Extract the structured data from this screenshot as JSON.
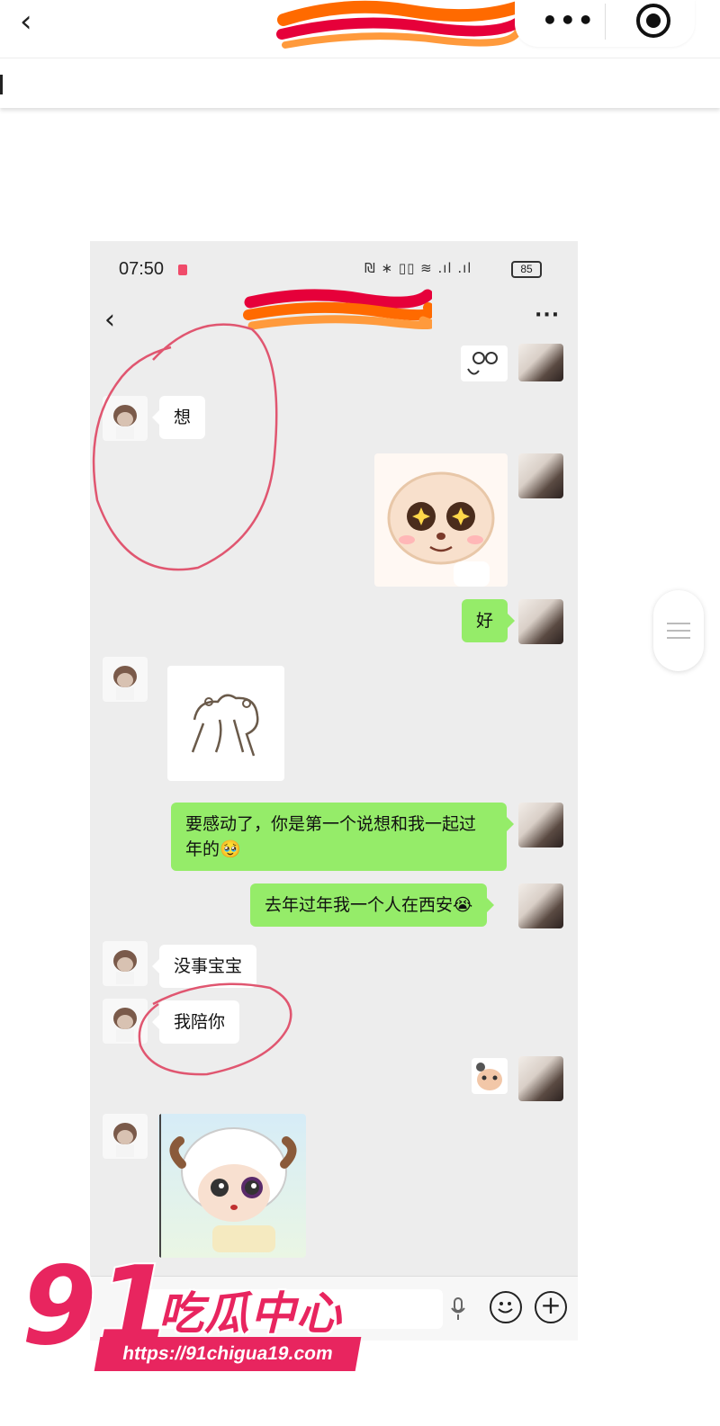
{
  "browser": {
    "back_icon": "back-chevron-icon",
    "more_icon": "more-dots-icon",
    "close_icon": "target-circle-icon"
  },
  "status_bar": {
    "time": "07:50",
    "icons": "₪ ∗ ▯▯ ≋ .ıl .ıl",
    "battery": "85"
  },
  "chat": {
    "more_label": "···",
    "messages": [
      {
        "from": "other",
        "type": "text",
        "text": "想"
      },
      {
        "from": "self",
        "type": "sticker",
        "sticker": "sheep-starry-eyes"
      },
      {
        "from": "self",
        "type": "text",
        "text": "好"
      },
      {
        "from": "other",
        "type": "sticker",
        "sticker": "hug-drawing"
      },
      {
        "from": "self",
        "type": "text",
        "text": "要感动了，你是第一个说想和我一起过年的🥹"
      },
      {
        "from": "self",
        "type": "text",
        "text": "去年过年我一个人在西安😭"
      },
      {
        "from": "other",
        "type": "text",
        "text": "没事宝宝"
      },
      {
        "from": "other",
        "type": "text",
        "text": "我陪你"
      },
      {
        "from": "other",
        "type": "sticker",
        "sticker": "sheep-bruised-eye"
      }
    ]
  },
  "watermark": {
    "number": "91",
    "title": "吃瓜中心",
    "url": "https://91chigua19.com"
  },
  "colors": {
    "chat_bg": "#ededed",
    "bubble_green": "#95ec69",
    "annotation_red": "#e05670",
    "watermark_pink": "#e8255f"
  }
}
